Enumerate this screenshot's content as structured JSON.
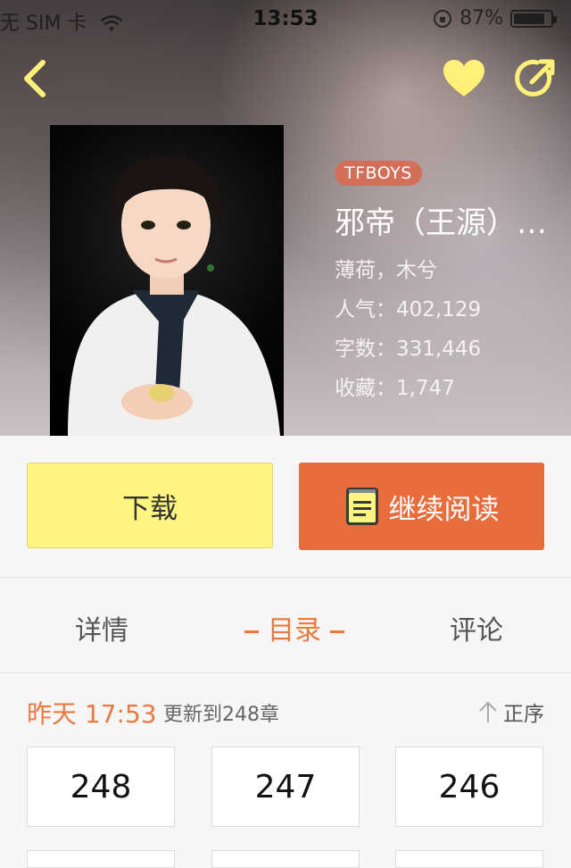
{
  "status_bar": {
    "carrier": "无 SIM 卡",
    "time": "13:53",
    "battery": "87%"
  },
  "colors": {
    "accent_orange": "#e96c3d",
    "download_yellow": "#fdf57f",
    "icon_yellow": "#fff07a",
    "tag_bg": "#d36f58"
  },
  "book": {
    "tag": "TFBOYS",
    "title": "邪帝（王源）…",
    "author": "薄荷，木兮",
    "popularity": "人气：402,129",
    "word_count": "字数：331,446",
    "favorites": "收藏：1,747"
  },
  "actions": {
    "download": "下载",
    "continue_reading": "继续阅读"
  },
  "tabs": {
    "details": "详情",
    "contents": "目录",
    "comments": "评论"
  },
  "update": {
    "time": "昨天 17:53",
    "text": "更新到248章",
    "sort": "正序"
  },
  "chapters": [
    "248",
    "247",
    "246"
  ],
  "icons": [
    "back-icon",
    "heart-icon",
    "share-icon",
    "book-icon",
    "arrow-up-icon",
    "wifi-icon",
    "battery-icon"
  ]
}
